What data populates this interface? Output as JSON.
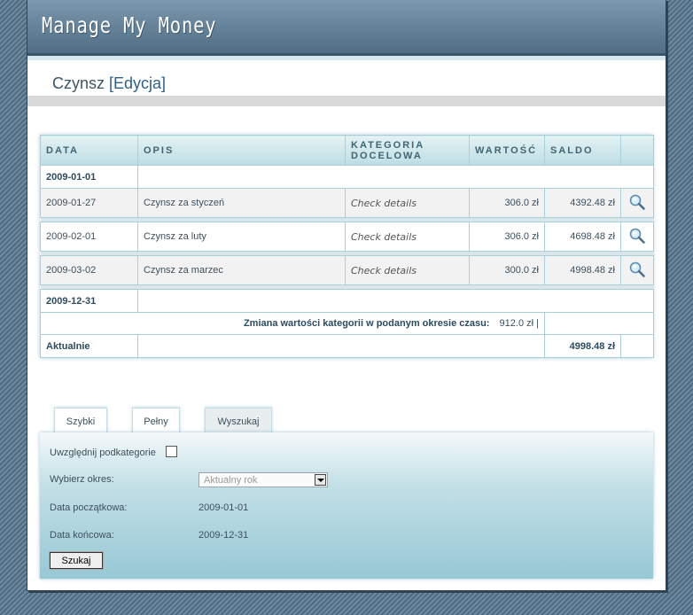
{
  "header": {
    "app_title": "Manage My Money"
  },
  "page": {
    "heading_main": "Czynsz ",
    "heading_mode": "[Edycja]"
  },
  "table": {
    "columns": [
      "DATA",
      "OPIS",
      "KATEGORIA DOCELOWA",
      "WARTOŚĆ",
      "SALDO"
    ],
    "start_date": "2009-01-01",
    "rows": [
      {
        "date": "2009-01-27",
        "desc": "Czynsz za styczeń",
        "category": "Check details",
        "value": "306.0 zł",
        "balance": "4392.48 zł"
      },
      {
        "date": "2009-02-01",
        "desc": "Czynsz za luty",
        "category": "Check details",
        "value": "306.0 zł",
        "balance": "4698.48 zł"
      },
      {
        "date": "2009-03-02",
        "desc": "Czynsz za marzec",
        "category": "Check details",
        "value": "300.0 zł",
        "balance": "4998.48 zł"
      }
    ],
    "end_date": "2009-12-31",
    "change_label": "Zmiana wartości kategorii w podanym okresie czasu:",
    "change_value": "912.0 zł |",
    "current_label": "Aktualnie",
    "current_value": "4998.48 zł"
  },
  "tabs": [
    "Szybki",
    "Pełny",
    "Wyszukaj"
  ],
  "filter": {
    "subcategories_label": "Uwzględnij podkategorie",
    "period_label": "Wybierz okres:",
    "period_value": "Aktualny rok",
    "start_label": "Data początkowa:",
    "start_value": "2009-01-01",
    "end_label": "Data końcowa:",
    "end_value": "2009-12-31",
    "search_button": "Szukaj"
  },
  "icons": {
    "details": "magnifier-icon"
  }
}
